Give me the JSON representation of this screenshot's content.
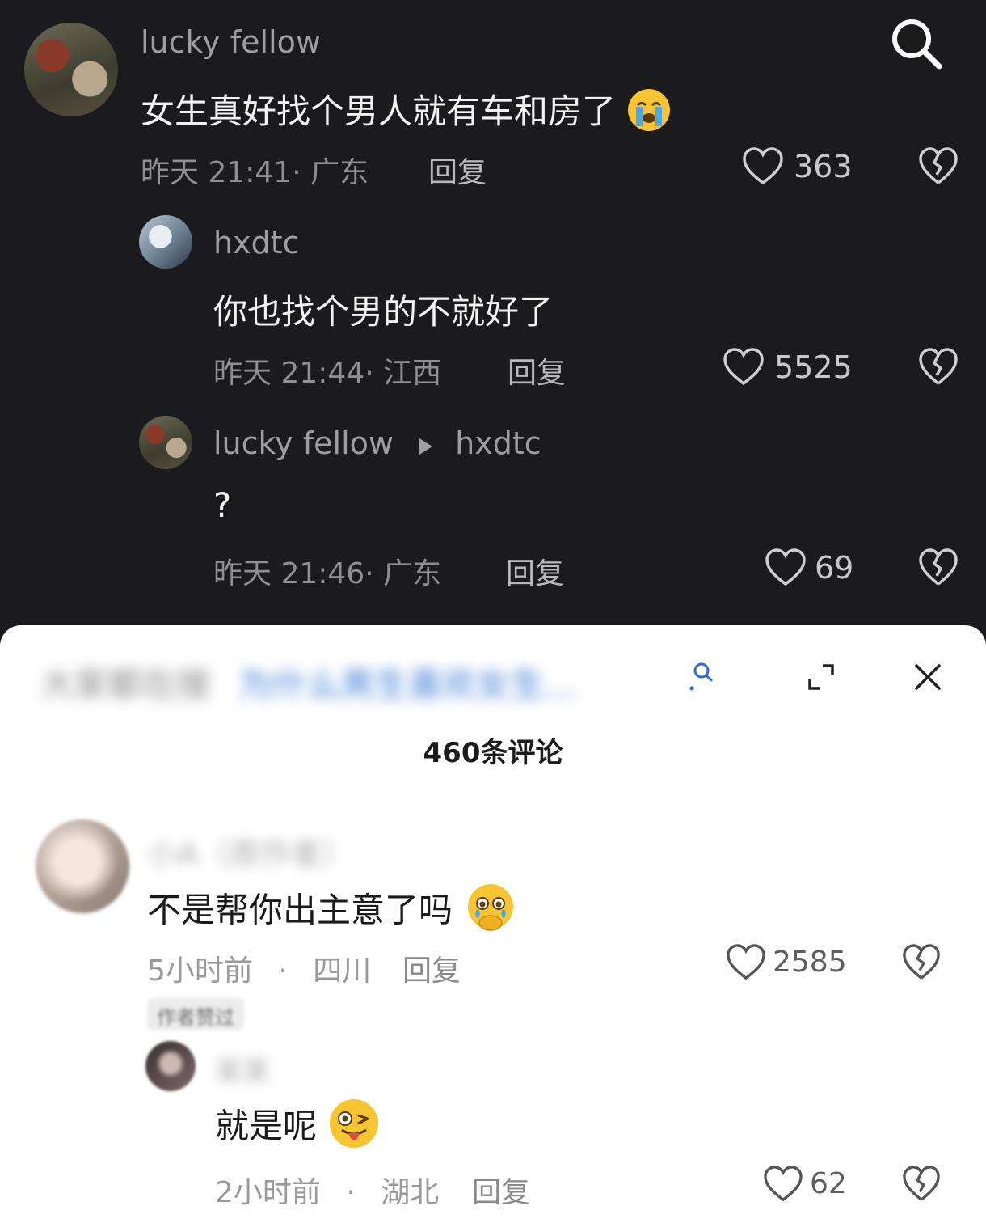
{
  "thread": {
    "comment1": {
      "author": "lucky fellow",
      "text": "女生真好找个男人就有车和房了",
      "emoji": "loudly-crying-face",
      "meta": "昨天 21:41· 广东",
      "reply_label": "回复",
      "likes": "363"
    },
    "reply1": {
      "author": "hxdtc",
      "text": "你也找个男的不就好了",
      "meta": "昨天 21:44· 江西",
      "reply_label": "回复",
      "likes": "5525"
    },
    "reply2": {
      "author": "lucky fellow",
      "reply_to": "hxdtc",
      "text": "?",
      "meta": "昨天 21:46· 广东",
      "reply_label": "回复",
      "likes": "69"
    }
  },
  "panel": {
    "search_prefix": "大家都在搜",
    "search_query": "为什么男生喜欢女生...",
    "title": "460条评论",
    "comment1": {
      "author": "小A（原作者）",
      "text": "不是帮你出主意了吗",
      "emoji": "face-holding-back-tears",
      "time": "5小时前",
      "location": "四川",
      "reply_label": "回复",
      "likes": "2585",
      "tag": "作者赞过"
    },
    "reply1": {
      "author": "某某",
      "text": "就是呢",
      "emoji": "winking-face-with-tongue",
      "time": "2小时前",
      "location": "湖北",
      "reply_label": "回复",
      "likes": "62"
    }
  },
  "colors": {
    "dark_bg": "#1b1b1e",
    "panel_bg": "#ffffff",
    "emoji_yellow": "#f7c531",
    "search_blue": "#3a7bd5"
  }
}
